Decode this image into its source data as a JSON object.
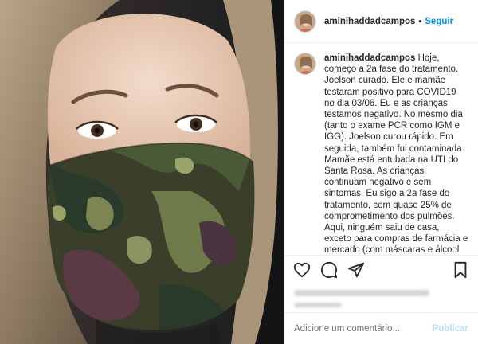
{
  "post": {
    "username": "aminihaddadcampos",
    "separator": "•",
    "follow_label": "Seguir"
  },
  "caption": {
    "username": "aminihaddadcampos",
    "text": "Hoje, começo a 2a fase do tratamento. Joelson curado. Ele e mamãe testaram positivo para COVID19 no dia 03/06. Eu e as crianças testamos negativo. No mesmo dia (tanto o exame PCR como IGM e IGG). Joelson curou rápido. Em seguida, também fui contaminada. Mamãe está entubada na UTI do Santa Rosa. As crianças continuam negativo e sem sintomas. Eu sigo a 2a fase do tratamento, com quase 25% de comprometimento dos pulmões. Aqui, ninguém saiu de casa, exceto para compras de farmácia e mercado (com máscaras e álcool gel). Fizemos teletrabalho. Joelson foi quem mais saiu para fazer as compras de mercado. Então, muita cautela com"
  },
  "actions": {
    "like_icon": "heart-icon",
    "comment_icon": "comment-icon",
    "share_icon": "share-icon",
    "save_icon": "bookmark-icon"
  },
  "comment_box": {
    "placeholder": "Adicione um comentário...",
    "publish_label": "Publicar"
  },
  "colors": {
    "accent": "#0095f6",
    "publish_disabled": "#b2dffc"
  }
}
